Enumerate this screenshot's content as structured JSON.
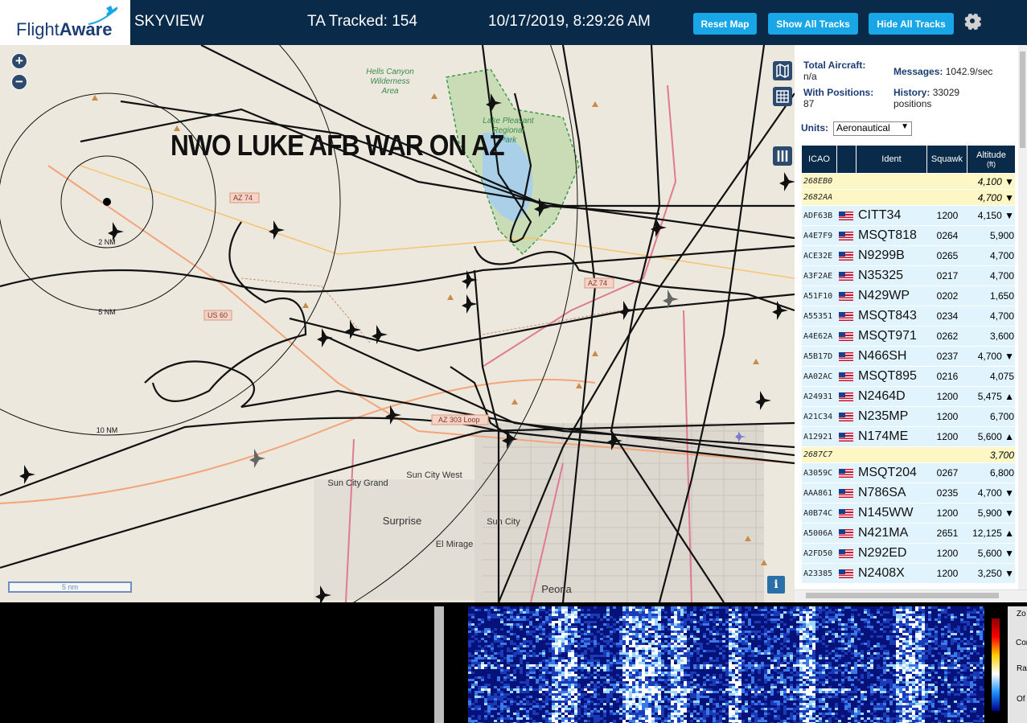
{
  "header": {
    "logo_text_a": "Flight",
    "logo_text_b": "Aware",
    "app_title": "SKYVIEW",
    "tracked": "TA Tracked: 154",
    "datetime": "10/17/2019, 8:29:26 AM",
    "buttons": {
      "reset": "Reset Map",
      "show_all": "Show All Tracks",
      "hide_all": "Hide All Tracks"
    },
    "settings_icon": "gear-icon"
  },
  "map": {
    "overlay_title": "NWO LUKE AFB WAR ON AZ",
    "scale_label": "5 nm",
    "info_label": "i",
    "range_rings": [
      "2 NM",
      "5 NM",
      "10 NM"
    ],
    "place_labels": [
      "Hells Canyon",
      "Wilderness",
      "Area",
      "Lake Pleasant",
      "Regional",
      "Park",
      "Sun City Grand",
      "Sun City West",
      "Sun City",
      "Surprise",
      "El Mirage",
      "Peoria"
    ],
    "road_labels": [
      "AZ 74",
      "AZ 74",
      "US 60",
      "AZ 303 Loop"
    ]
  },
  "sidebar": {
    "total_aircraft_label": "Total Aircraft:",
    "total_aircraft_value": "n/a",
    "with_positions_label": "With Positions:",
    "with_positions_value": "87",
    "messages_label": "Messages:",
    "messages_value": "1042.9/sec",
    "history_label": "History:",
    "history_value": "33029",
    "history_unit": "positions",
    "units_label": "Units:",
    "units_value": "Aeronautical",
    "columns": {
      "icao": "ICAO",
      "ident": "Ident",
      "squawk": "Squawk",
      "altitude": "Altitude",
      "altitude_unit": "(ft)"
    },
    "rows": [
      {
        "icao": "268EB0",
        "flag": false,
        "ident": "",
        "squawk": "",
        "alt": "4,100 ▼",
        "nopos": true
      },
      {
        "icao": "2682AA",
        "flag": false,
        "ident": "",
        "squawk": "",
        "alt": "4,700 ▼",
        "nopos": true
      },
      {
        "icao": "ADF63B",
        "flag": true,
        "ident": "CITT34",
        "squawk": "1200",
        "alt": "4,150 ▼",
        "nopos": false
      },
      {
        "icao": "A4E7F9",
        "flag": true,
        "ident": "MSQT818",
        "squawk": "0264",
        "alt": "5,900",
        "nopos": false
      },
      {
        "icao": "ACE32E",
        "flag": true,
        "ident": "N9299B",
        "squawk": "0265",
        "alt": "4,700",
        "nopos": false
      },
      {
        "icao": "A3F2AE",
        "flag": true,
        "ident": "N35325",
        "squawk": "0217",
        "alt": "4,700",
        "nopos": false
      },
      {
        "icao": "A51F10",
        "flag": true,
        "ident": "N429WP",
        "squawk": "0202",
        "alt": "1,650",
        "nopos": false
      },
      {
        "icao": "A55351",
        "flag": true,
        "ident": "MSQT843",
        "squawk": "0234",
        "alt": "4,700",
        "nopos": false
      },
      {
        "icao": "A4E62A",
        "flag": true,
        "ident": "MSQT971",
        "squawk": "0262",
        "alt": "3,600",
        "nopos": false
      },
      {
        "icao": "A5B17D",
        "flag": true,
        "ident": "N466SH",
        "squawk": "0237",
        "alt": "4,700 ▼",
        "nopos": false
      },
      {
        "icao": "AA02AC",
        "flag": true,
        "ident": "MSQT895",
        "squawk": "0216",
        "alt": "4,075",
        "nopos": false
      },
      {
        "icao": "A24931",
        "flag": true,
        "ident": "N2464D",
        "squawk": "1200",
        "alt": "5,475 ▲",
        "nopos": false
      },
      {
        "icao": "A21C34",
        "flag": true,
        "ident": "N235MP",
        "squawk": "1200",
        "alt": "6,700",
        "nopos": false
      },
      {
        "icao": "A12921",
        "flag": true,
        "ident": "N174ME",
        "squawk": "1200",
        "alt": "5,600 ▲",
        "nopos": false
      },
      {
        "icao": "2687C7",
        "flag": false,
        "ident": "",
        "squawk": "",
        "alt": "3,700",
        "nopos": true
      },
      {
        "icao": "A3059C",
        "flag": true,
        "ident": "MSQT204",
        "squawk": "0267",
        "alt": "6,800",
        "nopos": false
      },
      {
        "icao": "AAA861",
        "flag": true,
        "ident": "N786SA",
        "squawk": "0235",
        "alt": "4,700 ▼",
        "nopos": false
      },
      {
        "icao": "A0B74C",
        "flag": true,
        "ident": "N145WW",
        "squawk": "1200",
        "alt": "5,900 ▼",
        "nopos": false
      },
      {
        "icao": "A5006A",
        "flag": true,
        "ident": "N421MA",
        "squawk": "2651",
        "alt": "12,125 ▲",
        "nopos": false
      },
      {
        "icao": "A2FD50",
        "flag": true,
        "ident": "N292ED",
        "squawk": "1200",
        "alt": "5,600 ▼",
        "nopos": false
      },
      {
        "icao": "A23385",
        "flag": true,
        "ident": "N2408X",
        "squawk": "1200",
        "alt": "3,250 ▼",
        "nopos": false
      }
    ]
  },
  "waterfall": {
    "panel_labels": [
      "Zo",
      "Con",
      "Ra",
      "Of"
    ]
  },
  "colors": {
    "header_bg": "#0a2a4a",
    "button_bg": "#19a6e6",
    "row_bg": "#e1f3fc",
    "nopos_row_bg": "#fdf6c5"
  }
}
